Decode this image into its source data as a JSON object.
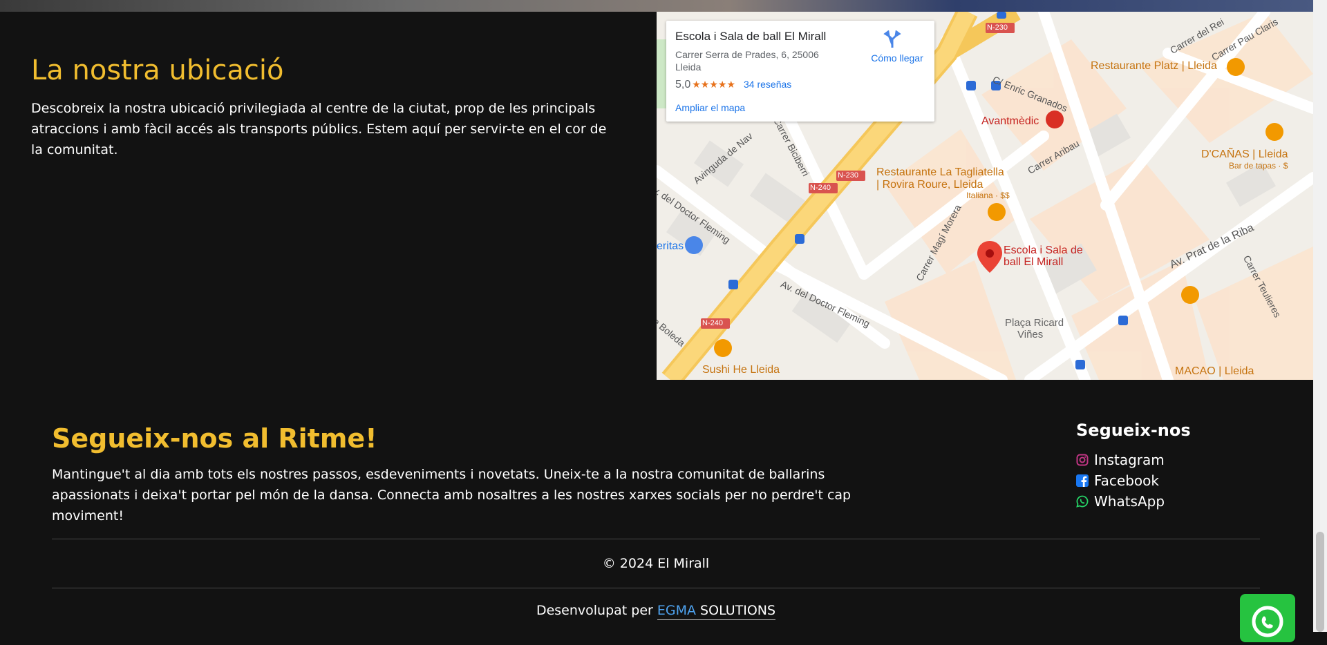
{
  "location": {
    "title": "La nostra ubicació",
    "description": "Descobreix la nostra ubicació privilegiada al centre de la ciutat, prop de les principals atraccions i amb fàcil accés als transports públics. Estem aquí per servir-te en el cor de la comunitat."
  },
  "map": {
    "card": {
      "place_name": "Escola i Sala de ball El Mirall",
      "address": "Carrer Serra de Prades, 6, 25006 Lleida",
      "rating": "5,0",
      "stars": "★★★★★",
      "reviews": "34 reseñas",
      "enlarge": "Ampliar el mapa",
      "directions": "Cómo llegar"
    },
    "labels": {
      "restaurante_platz": "Restaurante Platz | Lleida",
      "avantmedic": "Avantmèdic",
      "dcanas": "D'CAÑAS | Lleida",
      "dcanas_sub": "Bar de tapas · $",
      "tagliatella_1": "Restaurante La Tagliatella",
      "tagliatella_2": "| Rovira Roure, Lleida",
      "tagliatella_sub": "Italiana · $$",
      "pin_1": "Escola i Sala de",
      "pin_2": "ball El Mirall",
      "placa_1": "Plaça Ricard",
      "placa_2": "Viñes",
      "sushi": "Sushi He Lleida",
      "macao": "MACAO | Lleida",
      "eritas": "eritas",
      "av_prat": "Av. Prat de la Riba",
      "av_doctor_fleming": "Av. del Doctor Fleming",
      "doctor_fleming_left": "v. del Doctor Fleming",
      "magi_morera": "Carrer Magí Morera",
      "carrer_aribau": "Carrer Aribau",
      "enric_granados": "C/ Enric Granados",
      "biciberri": "Carrer Biciberri",
      "av_navarra": "Avinguda de Nav",
      "boleda": "e Boleda",
      "teulieres": "Carrer Teulieres",
      "pau_claris": "Carrer Pau Claris",
      "carrer_rei": "Carrer del Rei",
      "n230_a": "N-230",
      "n230_b": "N-230",
      "n240_a": "N-240",
      "n240_b": "N-240"
    }
  },
  "footer": {
    "heading": "Segueix-nos al Ritme!",
    "text": "Mantingue't al dia amb tots els nostres passos, esdeveniments i novetats. Uneix-te a la nostra comunitat de ballarins apassionats i deixa't portar pel món de la dansa. Connecta amb nosaltres a les nostres xarxes socials per no perdre't cap moviment!",
    "social_title": "Segueix-nos",
    "social": [
      {
        "label": "Instagram",
        "icon": "instagram-icon",
        "color": "#c13584"
      },
      {
        "label": "Facebook",
        "icon": "facebook-icon",
        "color": "#1877f2"
      },
      {
        "label": "WhatsApp",
        "icon": "whatsapp-icon",
        "color": "#25d366"
      }
    ],
    "copyright": "© 2024 El Mirall",
    "developed_by": "Desenvolupat per",
    "brand_a": "EGMA",
    "brand_b": " SOLUTIONS"
  },
  "colors": {
    "accent": "#f1bd2f",
    "background": "#121212",
    "whatsapp_float": "#26c340"
  }
}
